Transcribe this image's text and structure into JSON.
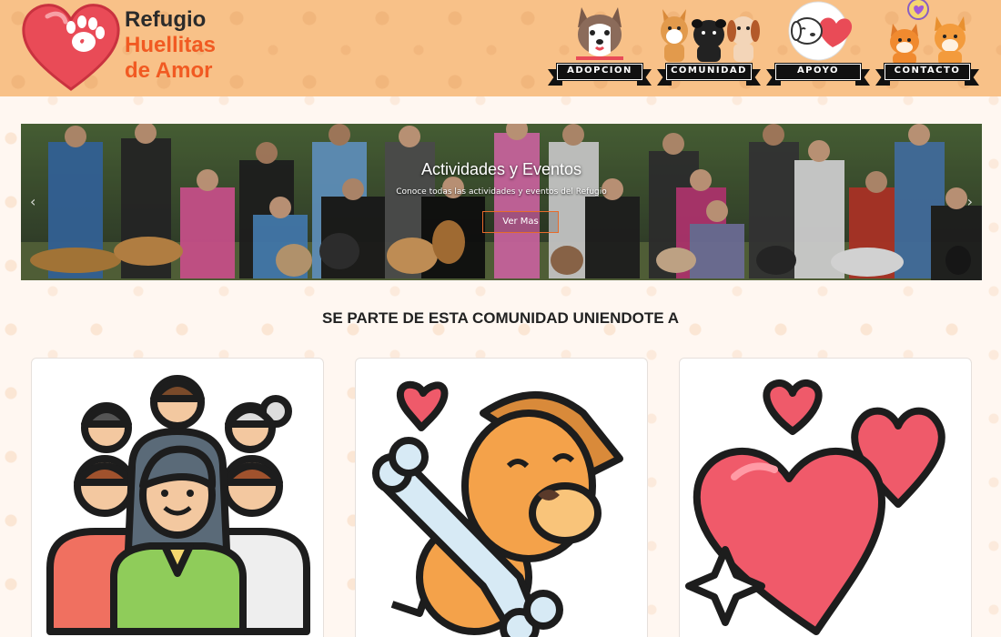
{
  "brand": {
    "line1": "Refugio",
    "line2": "Huellitas",
    "line3": "de Amor",
    "logo_icon": "heart-paw-icon"
  },
  "nav": [
    {
      "label": "ADOPCION",
      "icon": "husky-icon"
    },
    {
      "label": "COMUNIDAD",
      "icon": "dogs-group-icon"
    },
    {
      "label": "APOYO",
      "icon": "dog-hug-heart-icon"
    },
    {
      "label": "CONTACTO",
      "icon": "shiba-chat-icon"
    }
  ],
  "hero": {
    "title": "Actividades y Eventos",
    "subtitle": "Conoce todas las actividades y eventos del Refugio",
    "button_label": "Ver Mas",
    "prev_arrow": "‹",
    "next_arrow": "›"
  },
  "section": {
    "title": "SE PARTE DE ESTA COMUNIDAD UNIENDOTE A"
  },
  "cards": [
    {
      "icon": "community-people-icon"
    },
    {
      "icon": "dog-bone-heart-icon"
    },
    {
      "icon": "hearts-sparkle-icon"
    }
  ],
  "colors": {
    "header_bg": "#f8c188",
    "brand_orange": "#f15a22",
    "accent_red": "#e94b57"
  }
}
